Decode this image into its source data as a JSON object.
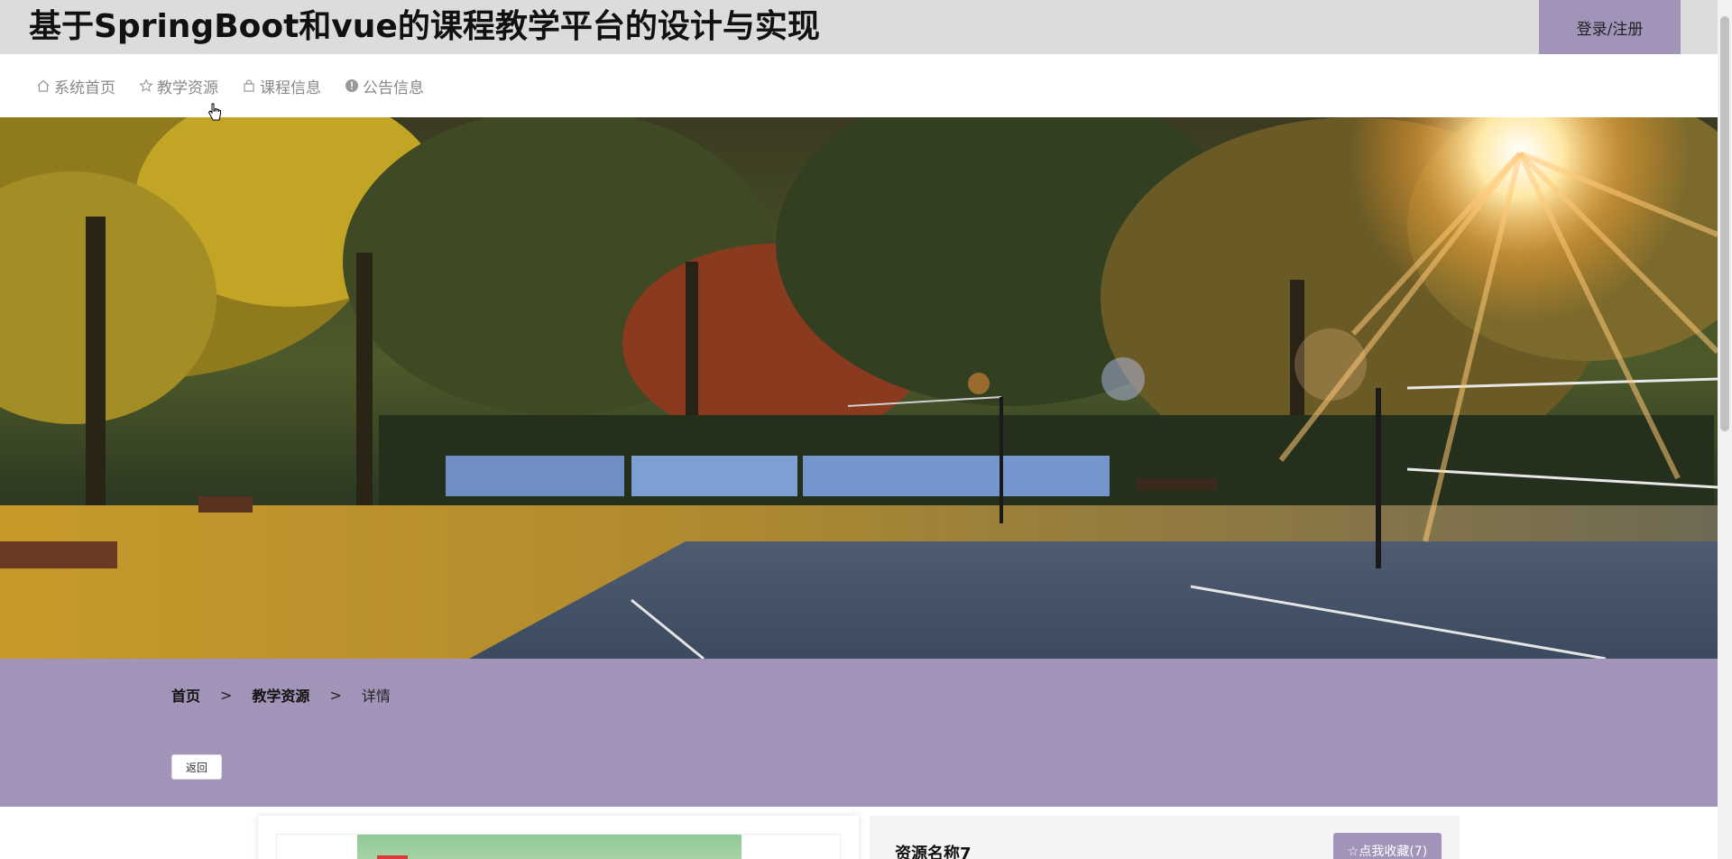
{
  "header": {
    "title": "基于SpringBoot和vue的课程教学平台的设计与实现",
    "login_label": "登录/注册"
  },
  "nav": {
    "items": [
      {
        "label": "系统首页",
        "icon": "home-icon"
      },
      {
        "label": "教学资源",
        "icon": "star-icon"
      },
      {
        "label": "课程信息",
        "icon": "bag-icon"
      },
      {
        "label": "公告信息",
        "icon": "info-circle-icon"
      }
    ]
  },
  "breadcrumb": {
    "home": "首页",
    "section": "教学资源",
    "current": "详情",
    "separator": ">"
  },
  "actions": {
    "back_label": "返回"
  },
  "detail": {
    "resource_name": "资源名称7",
    "favorite_label": "☆点我收藏(7)"
  },
  "colors": {
    "accent": "#a294b8",
    "header_bg": "#dcdcdc"
  }
}
